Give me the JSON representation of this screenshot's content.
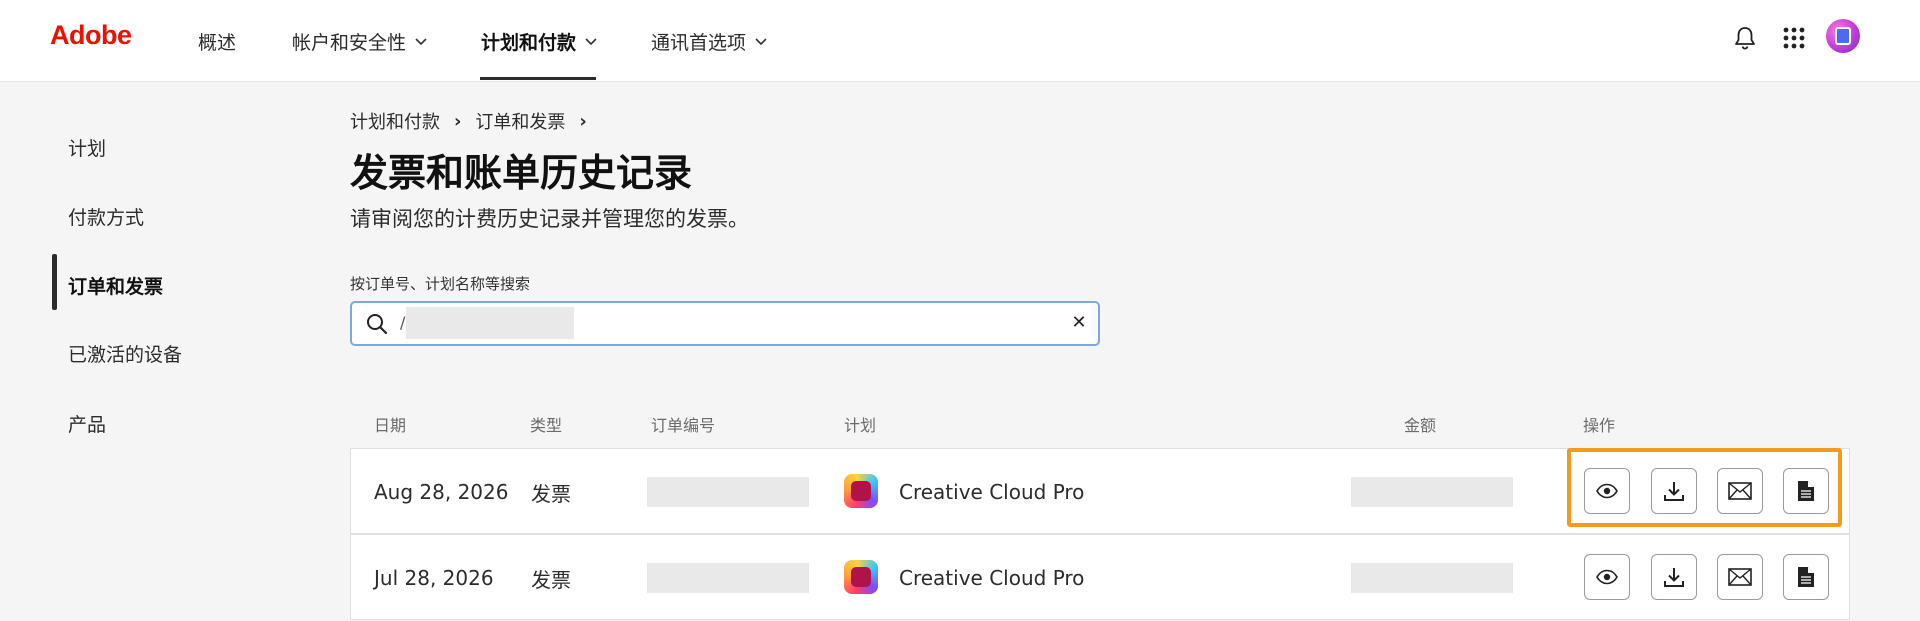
{
  "header": {
    "logo": "Adobe",
    "nav": [
      {
        "label": "概述"
      },
      {
        "label": "帐户和安全性"
      },
      {
        "label": "计划和付款"
      },
      {
        "label": "通讯首选项"
      }
    ]
  },
  "sidebar": {
    "items": [
      {
        "label": "计划"
      },
      {
        "label": "付款方式"
      },
      {
        "label": "订单和发票"
      },
      {
        "label": "已激活的设备"
      },
      {
        "label": "产品"
      }
    ]
  },
  "breadcrumb": [
    "计划和付款",
    "订单和发票"
  ],
  "page": {
    "title": "发票和账单历史记录",
    "subtitle": "请审阅您的计费历史记录并管理您的发票。"
  },
  "search": {
    "label": "按订单号、计划名称等搜索",
    "value": "/"
  },
  "table": {
    "headers": [
      "日期",
      "类型",
      "订单编号",
      "计划",
      "金额",
      "操作"
    ],
    "rows": [
      {
        "date": "Aug 28, 2026",
        "type": "发票",
        "plan": "Creative Cloud Pro"
      },
      {
        "date": "Jul 28, 2026",
        "type": "发票",
        "plan": "Creative Cloud Pro"
      }
    ]
  },
  "colors": {
    "brand": "#eb1000",
    "highlight": "#f39b1f",
    "search_border": "#7fa8d6"
  },
  "icons": [
    "bell-icon",
    "app-grid-icon",
    "search-icon",
    "clear-icon",
    "view-icon",
    "download-icon",
    "email-icon",
    "document-icon",
    "creative-cloud-icon"
  ]
}
